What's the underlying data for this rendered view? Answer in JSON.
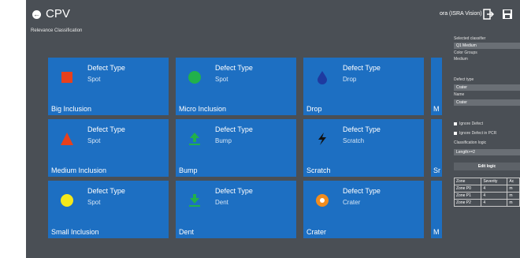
{
  "header": {
    "app_title": "CPV",
    "subtitle": "Relevance Classification",
    "user": "ora (ISRA Vision)"
  },
  "tiles": [
    {
      "defect_label": "Defect Type",
      "defect_type": "Spot",
      "name": "Big Inclusion",
      "icon": "red-square-icon",
      "icon_color": "#e8401c"
    },
    {
      "defect_label": "Defect Type",
      "defect_type": "Spot",
      "name": "Micro Inclusion",
      "icon": "green-circle-icon",
      "icon_color": "#21b14b"
    },
    {
      "defect_label": "Defect Type",
      "defect_type": "Drop",
      "name": "Drop",
      "icon": "drop-icon",
      "icon_color": "#1e3aa0"
    },
    {
      "defect_label": "Defect Type",
      "defect_type": "Spot",
      "name": "Medium Inclusion",
      "icon": "red-triangle-icon",
      "icon_color": "#e8401c"
    },
    {
      "defect_label": "Defect Type",
      "defect_type": "Bump",
      "name": "Bump",
      "icon": "bump-icon",
      "icon_color": "#21b14b"
    },
    {
      "defect_label": "Defect Type",
      "defect_type": "Scratch",
      "name": "Scratch",
      "icon": "scratch-icon",
      "icon_color": "#111111"
    },
    {
      "defect_label": "Defect Type",
      "defect_type": "Spot",
      "name": "Small Inclusion",
      "icon": "yellow-circle-icon",
      "icon_color": "#f4e81a"
    },
    {
      "defect_label": "Defect Type",
      "defect_type": "Dent",
      "name": "Dent",
      "icon": "dent-icon",
      "icon_color": "#21b14b"
    },
    {
      "defect_label": "Defect Type",
      "defect_type": "Crater",
      "name": "Crater",
      "icon": "crater-icon",
      "icon_color": "#f08c1e"
    }
  ],
  "partial_tiles": [
    "M",
    "Sr",
    "M"
  ],
  "panel": {
    "selected_classifier_label": "Selected classifier",
    "selected_classifier": "Q1 Medium",
    "color_groups_label": "Color Groups",
    "color_groups_value": "Medium",
    "defect_type_label": "Defect type",
    "defect_type": "Crater",
    "name_label": "Name",
    "name": "Crater",
    "ignore_defect": "Ignore Defect",
    "ignore_defect_pcr": "Ignore Defect in PCR",
    "classification_logic_label": "Classification logic",
    "classification_logic": "Length>=2",
    "edit_logic": "Edit logic",
    "zone_headers": [
      "Zone",
      "Severity",
      "Ac"
    ],
    "zones": [
      [
        "Zone P0",
        "4",
        "m"
      ],
      [
        "Zone P1",
        "4",
        "m"
      ],
      [
        "Zone P2",
        "4",
        "m"
      ]
    ]
  }
}
